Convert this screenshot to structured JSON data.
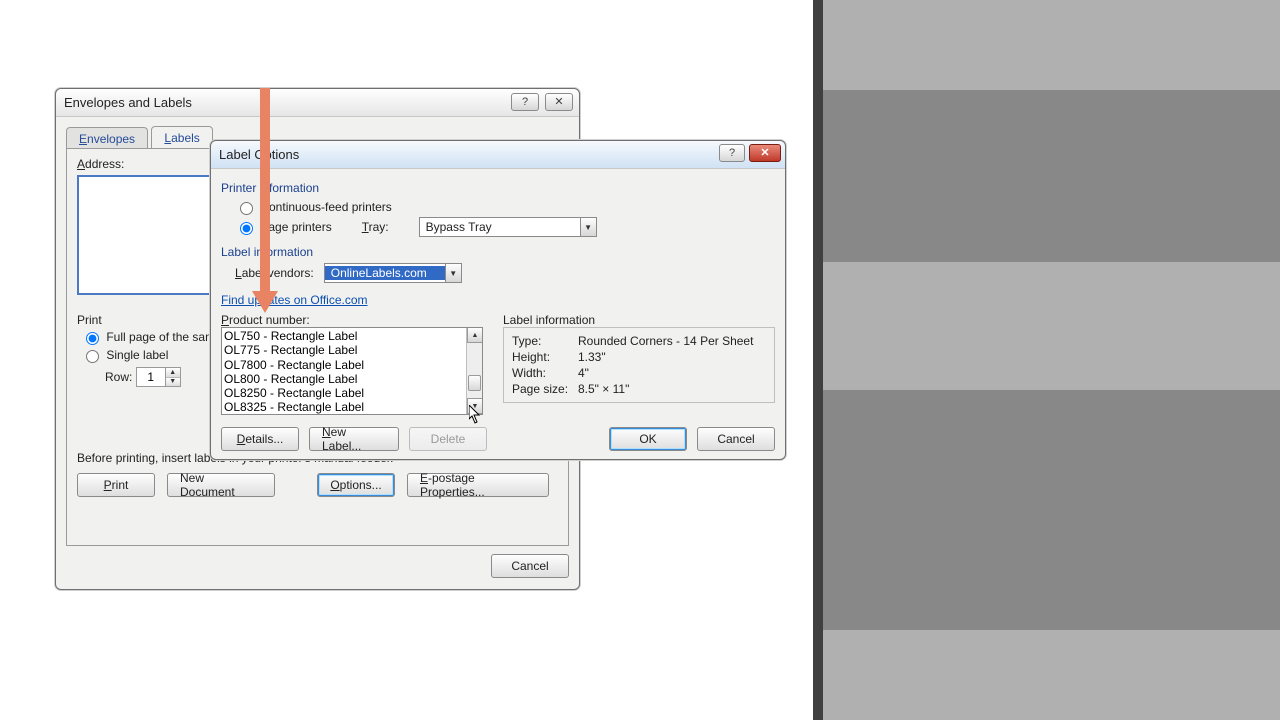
{
  "envelopes_dialog": {
    "title": "Envelopes and Labels",
    "tabs": {
      "envelopes": "Envelopes",
      "labels": "Labels"
    },
    "address_label": "Address:",
    "print_group": "Print",
    "full_page": "Full page of the same label",
    "single_label": "Single label",
    "row_label": "Row:",
    "row_value": "1",
    "feeder_note": "Before printing, insert labels in your printer's manual feeder.",
    "buttons": {
      "print": "Print",
      "new_document": "New Document",
      "options": "Options...",
      "epostage": "E-postage Properties...",
      "cancel": "Cancel"
    }
  },
  "label_options": {
    "title": "Label Options",
    "printer_info": "Printer information",
    "continuous": "Continuous-feed printers",
    "page_printers": "Page printers",
    "tray_label": "Tray:",
    "tray_value": "Bypass Tray",
    "label_info_section": "Label information",
    "vendors_label": "Label vendors:",
    "vendor_value": "OnlineLabels.com",
    "updates_link": "Find updates on Office.com",
    "product_number_label": "Product number:",
    "products": [
      "OL750 - Rectangle Label",
      "OL775 - Rectangle Label",
      "OL7800 - Rectangle Label",
      "OL800 - Rectangle Label",
      "OL8250 - Rectangle Label",
      "OL8325 - Rectangle Label"
    ],
    "detail_header": "Label information",
    "detail": {
      "type_k": "Type:",
      "type_v": "Rounded Corners - 14 Per Sheet",
      "height_k": "Height:",
      "height_v": "1.33\"",
      "width_k": "Width:",
      "width_v": "4\"",
      "page_k": "Page size:",
      "page_v": "8.5\" × 11\""
    },
    "buttons": {
      "details": "Details...",
      "new_label": "New Label...",
      "delete": "Delete",
      "ok": "OK",
      "cancel": "Cancel"
    }
  }
}
